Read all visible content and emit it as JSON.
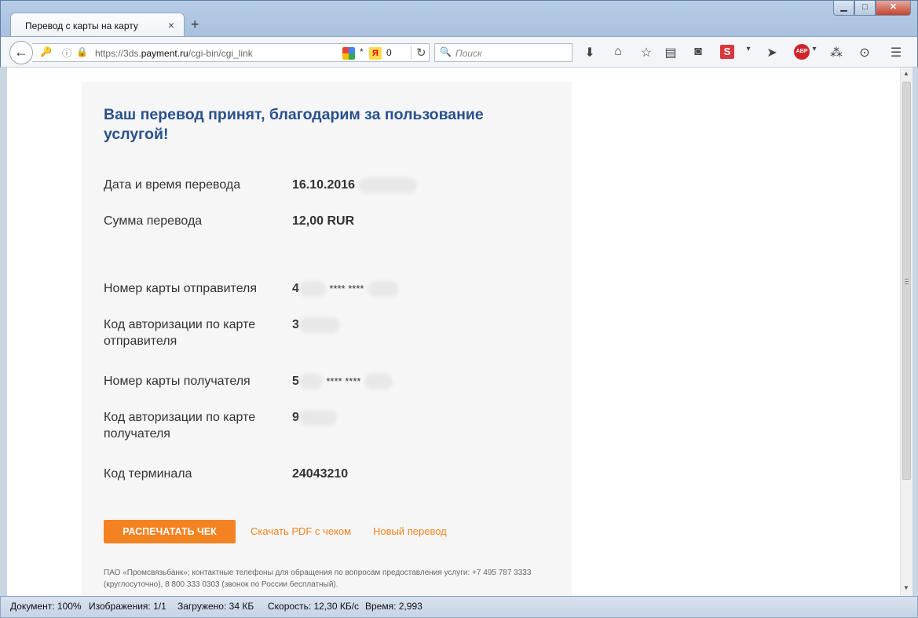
{
  "browser": {
    "tab_title": "Перевод с карты на карту",
    "tab_close": "×",
    "new_tab": "+",
    "url_prefix": "https://3ds.",
    "url_domain": "payment.ru",
    "url_path": "/cgi-bin/cgi_link",
    "url_star": "*",
    "yandex_glyph": "Я",
    "yandex_count": "0",
    "search_placeholder": "Поиск",
    "icons": [
      "back-icon",
      "key-icon",
      "info-icon",
      "lock-icon",
      "reload-icon",
      "search-icon",
      "download-icon",
      "home-icon",
      "bookmark-star-icon",
      "reading-list-icon",
      "pocket-icon",
      "s-extension-icon",
      "send-icon",
      "adblock-icon",
      "extension-icon",
      "settings-icon",
      "menu-icon"
    ]
  },
  "page": {
    "heading": "Ваш перевод принят, благодарим за пользование услугой!",
    "rows": [
      {
        "label": "Дата и время перевода",
        "value": "16.10.2016"
      },
      {
        "label": "Сумма перевода",
        "value": "12,00 RUR"
      },
      {
        "label": "Номер карты отправителя",
        "value_start": "4",
        "stars": "**** ****"
      },
      {
        "label": "Код авторизации по карте отправителя",
        "value": "3"
      },
      {
        "label": "Номер карты получателя",
        "value_start": "5",
        "stars": "**** ****"
      },
      {
        "label": "Код авторизации по карте получателя",
        "value": "9"
      },
      {
        "label": "Код терминала",
        "value": "24043210"
      }
    ],
    "print_button": "РАСПЕЧАТАТЬ ЧЕК",
    "pdf_link": "Скачать PDF с чеком",
    "new_transfer_link": "Новый перевод",
    "footer": "ПАО «Промсвязьбанк»; контактные телефоны для обращения по вопросам предоставления услуги: +7 495 787 3333 (круглосуточно), 8 800 333 0303 (звонок по России бесплатный)."
  },
  "status": {
    "document": "Документ: 100%",
    "images": "Изображения: 1/1",
    "loaded": "Загружено: 34 КБ",
    "speed": "Скорость: 12,30 КБ/с",
    "time": "Время: 2,993"
  },
  "colors": {
    "accent": "#f58220",
    "heading": "#29508d",
    "panel": "#f6f6f6"
  }
}
